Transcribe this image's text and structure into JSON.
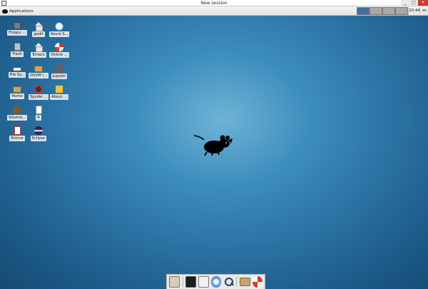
{
  "window": {
    "title": "New session",
    "controls": {
      "minimize": "_",
      "maximize": "□",
      "close": "✕"
    }
  },
  "panel": {
    "applications_label": "Applications",
    "workspaces": [
      "1",
      "2",
      "3",
      "4",
      "5"
    ],
    "active_workspace": 0,
    "clock": "20:44",
    "user": "dv"
  },
  "desktop_icons": [
    {
      "label": "Floppy ...",
      "icon": "floppy-icon"
    },
    {
      "label": "gedit",
      "icon": "home-folder-icon"
    },
    {
      "label": "Azure S...",
      "icon": "azure-icon"
    },
    {
      "label": "Trash",
      "icon": "trash-icon"
    },
    {
      "label": "Emacs",
      "icon": "home-folder-icon"
    },
    {
      "label": "Online ...",
      "icon": "help-lifebuoy-icon"
    },
    {
      "label": "File Sy...",
      "icon": "drive-icon"
    },
    {
      "label": "DSVM I...",
      "icon": "folder-icon"
    },
    {
      "label": "Jupyter",
      "icon": "jupyter-icon"
    },
    {
      "label": "Home",
      "icon": "folder-icon"
    },
    {
      "label": "Spyder ...",
      "icon": "spyder-icon"
    },
    {
      "label": "About ...",
      "icon": "about-icon"
    },
    {
      "label": "SQuirre...",
      "icon": "squirrel-icon"
    },
    {
      "label": "R",
      "icon": "document-icon"
    },
    {
      "label": "Evince",
      "icon": "evince-icon"
    },
    {
      "label": "Eclipse",
      "icon": "eclipse-icon"
    }
  ],
  "dock": [
    {
      "name": "show-desktop",
      "icon": "show-desktop-icon"
    },
    {
      "name": "terminal",
      "icon": "terminal-icon"
    },
    {
      "name": "file-manager",
      "icon": "file-manager-icon"
    },
    {
      "name": "web-browser",
      "icon": "web-browser-icon"
    },
    {
      "name": "app-finder",
      "icon": "search-icon"
    },
    {
      "name": "folder",
      "icon": "folder-icon"
    },
    {
      "name": "help",
      "icon": "help-lifebuoy-icon"
    }
  ],
  "colors": {
    "desktop_center": "#6fb3d6",
    "desktop_edge": "#154b73",
    "workspace_active": "#3e6fa3",
    "close_button": "#c83b2c"
  }
}
